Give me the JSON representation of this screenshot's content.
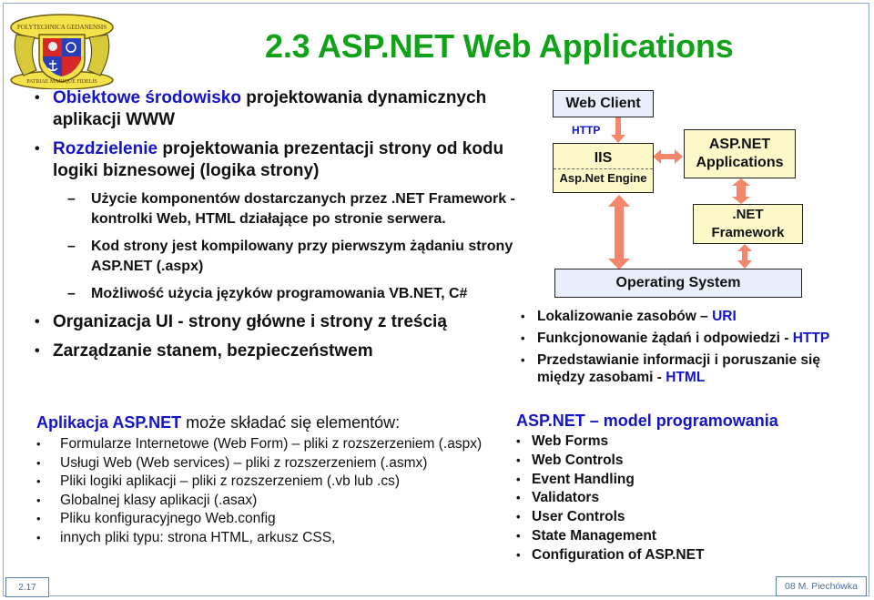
{
  "slide": {
    "title": "2.3 ASP.NET Web Applications",
    "slide_number": "2.17",
    "author": "08 M. Piechówka",
    "accent_color": "#1414c8",
    "title_color": "#12a21a"
  },
  "logo": {
    "icon": "university-crest-icon",
    "top_text": "POLYTECHNICA GEDANENSIS",
    "bottom_text": "PATRIAE MARIQUE FIDELIS"
  },
  "main_bullets": [
    {
      "highlight": "Obiektowe środowisko",
      "text": " projektowania dynamicznych aplikacji WWW"
    },
    {
      "highlight": "Rozdzielenie",
      "text": " projektowania prezentacji strony od kodu logiki biznesowej (logika strony)"
    }
  ],
  "sub_bullets": [
    "Użycie komponentów dostarczanych przez .NET Framework  - kontrolki Web, HTML działające po stronie serwera.",
    "Kod strony jest kompilowany przy pierwszym żądaniu strony ASP.NET (.aspx)",
    "Możliwość użycia języków programowania VB.NET, C#"
  ],
  "main_bullets_2": [
    "Organizacja UI - strony główne i strony z treścią",
    "Zarządzanie stanem, bezpieczeństwem"
  ],
  "diagram": {
    "web_client": "Web Client",
    "http_label": "HTTP",
    "iis": "IIS",
    "engine": "Asp.Net Engine",
    "asp_apps_line1": "ASP.NET",
    "asp_apps_line2": "Applications",
    "framework_line1": ".NET",
    "framework_line2": "Framework",
    "os": "Operating System",
    "arrow_color": "#f4866b"
  },
  "web_concepts": [
    {
      "text": "Lokalizowanie zasobów – ",
      "highlight": "URI"
    },
    {
      "text": "Funkcjonowanie żądań i odpowiedzi - ",
      "highlight": "HTTP"
    },
    {
      "text": "Przedstawianie informacji i poruszanie się między zasobami - ",
      "highlight": "HTML"
    }
  ],
  "app_elements": {
    "heading_highlight": "Aplikacja ASP.NET",
    "heading_text": " może składać się elementów:",
    "items": [
      "Formularze Internetowe (Web Form) – pliki z rozszerzeniem (.aspx)",
      "Usługi Web (Web services) – pliki z rozszerzeniem (.asmx)",
      "Pliki logiki aplikacji –  pliki z rozszerzeniem (.vb lub .cs)",
      "Globalnej klasy aplikacji (.asax)",
      "Pliku konfiguracyjnego Web.config",
      "innych pliki typu: strona HTML, arkusz CSS,"
    ]
  },
  "programming_model": {
    "heading": "ASP.NET – model  programowania",
    "items": [
      "Web Forms",
      "Web Controls",
      "Event Handling",
      "Validators",
      "User Controls",
      "State Management",
      "Configuration of ASP.NET"
    ]
  }
}
